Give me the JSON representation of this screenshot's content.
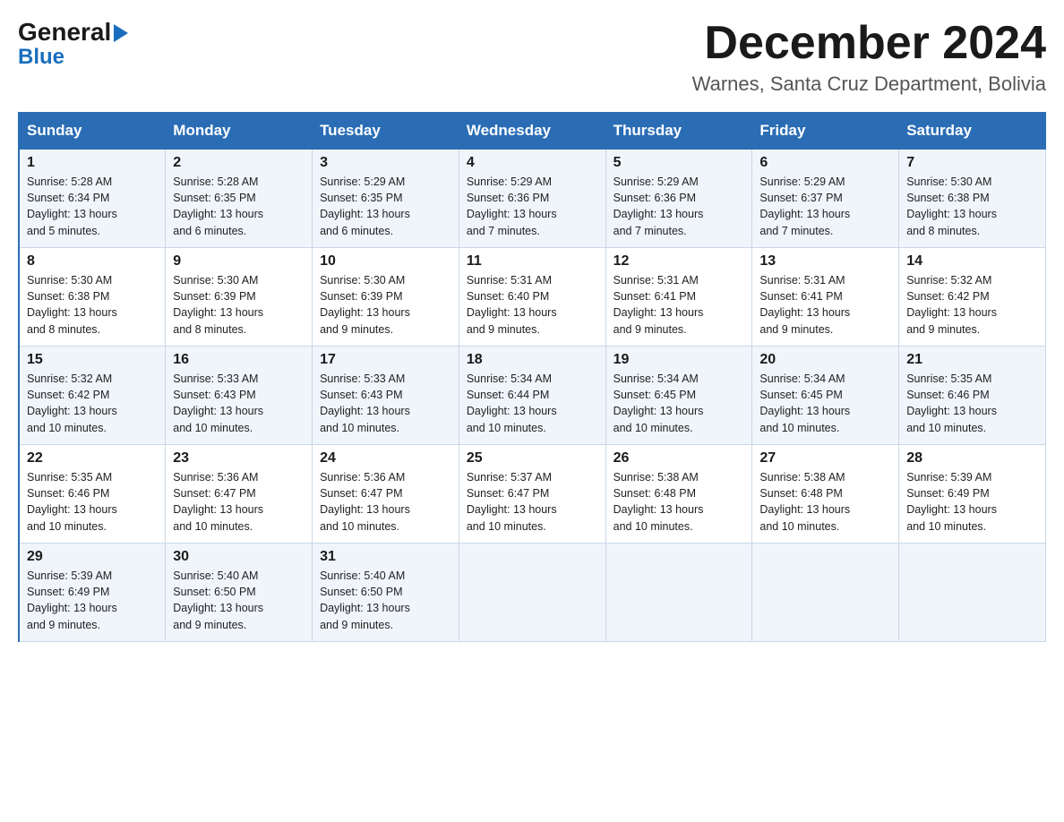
{
  "header": {
    "logo_general": "General",
    "logo_blue": "Blue",
    "month_title": "December 2024",
    "location": "Warnes, Santa Cruz Department, Bolivia"
  },
  "days_of_week": [
    "Sunday",
    "Monday",
    "Tuesday",
    "Wednesday",
    "Thursday",
    "Friday",
    "Saturday"
  ],
  "weeks": [
    [
      {
        "day": "1",
        "sunrise": "5:28 AM",
        "sunset": "6:34 PM",
        "daylight": "13 hours and 5 minutes."
      },
      {
        "day": "2",
        "sunrise": "5:28 AM",
        "sunset": "6:35 PM",
        "daylight": "13 hours and 6 minutes."
      },
      {
        "day": "3",
        "sunrise": "5:29 AM",
        "sunset": "6:35 PM",
        "daylight": "13 hours and 6 minutes."
      },
      {
        "day": "4",
        "sunrise": "5:29 AM",
        "sunset": "6:36 PM",
        "daylight": "13 hours and 7 minutes."
      },
      {
        "day": "5",
        "sunrise": "5:29 AM",
        "sunset": "6:36 PM",
        "daylight": "13 hours and 7 minutes."
      },
      {
        "day": "6",
        "sunrise": "5:29 AM",
        "sunset": "6:37 PM",
        "daylight": "13 hours and 7 minutes."
      },
      {
        "day": "7",
        "sunrise": "5:30 AM",
        "sunset": "6:38 PM",
        "daylight": "13 hours and 8 minutes."
      }
    ],
    [
      {
        "day": "8",
        "sunrise": "5:30 AM",
        "sunset": "6:38 PM",
        "daylight": "13 hours and 8 minutes."
      },
      {
        "day": "9",
        "sunrise": "5:30 AM",
        "sunset": "6:39 PM",
        "daylight": "13 hours and 8 minutes."
      },
      {
        "day": "10",
        "sunrise": "5:30 AM",
        "sunset": "6:39 PM",
        "daylight": "13 hours and 9 minutes."
      },
      {
        "day": "11",
        "sunrise": "5:31 AM",
        "sunset": "6:40 PM",
        "daylight": "13 hours and 9 minutes."
      },
      {
        "day": "12",
        "sunrise": "5:31 AM",
        "sunset": "6:41 PM",
        "daylight": "13 hours and 9 minutes."
      },
      {
        "day": "13",
        "sunrise": "5:31 AM",
        "sunset": "6:41 PM",
        "daylight": "13 hours and 9 minutes."
      },
      {
        "day": "14",
        "sunrise": "5:32 AM",
        "sunset": "6:42 PM",
        "daylight": "13 hours and 9 minutes."
      }
    ],
    [
      {
        "day": "15",
        "sunrise": "5:32 AM",
        "sunset": "6:42 PM",
        "daylight": "13 hours and 10 minutes."
      },
      {
        "day": "16",
        "sunrise": "5:33 AM",
        "sunset": "6:43 PM",
        "daylight": "13 hours and 10 minutes."
      },
      {
        "day": "17",
        "sunrise": "5:33 AM",
        "sunset": "6:43 PM",
        "daylight": "13 hours and 10 minutes."
      },
      {
        "day": "18",
        "sunrise": "5:34 AM",
        "sunset": "6:44 PM",
        "daylight": "13 hours and 10 minutes."
      },
      {
        "day": "19",
        "sunrise": "5:34 AM",
        "sunset": "6:45 PM",
        "daylight": "13 hours and 10 minutes."
      },
      {
        "day": "20",
        "sunrise": "5:34 AM",
        "sunset": "6:45 PM",
        "daylight": "13 hours and 10 minutes."
      },
      {
        "day": "21",
        "sunrise": "5:35 AM",
        "sunset": "6:46 PM",
        "daylight": "13 hours and 10 minutes."
      }
    ],
    [
      {
        "day": "22",
        "sunrise": "5:35 AM",
        "sunset": "6:46 PM",
        "daylight": "13 hours and 10 minutes."
      },
      {
        "day": "23",
        "sunrise": "5:36 AM",
        "sunset": "6:47 PM",
        "daylight": "13 hours and 10 minutes."
      },
      {
        "day": "24",
        "sunrise": "5:36 AM",
        "sunset": "6:47 PM",
        "daylight": "13 hours and 10 minutes."
      },
      {
        "day": "25",
        "sunrise": "5:37 AM",
        "sunset": "6:47 PM",
        "daylight": "13 hours and 10 minutes."
      },
      {
        "day": "26",
        "sunrise": "5:38 AM",
        "sunset": "6:48 PM",
        "daylight": "13 hours and 10 minutes."
      },
      {
        "day": "27",
        "sunrise": "5:38 AM",
        "sunset": "6:48 PM",
        "daylight": "13 hours and 10 minutes."
      },
      {
        "day": "28",
        "sunrise": "5:39 AM",
        "sunset": "6:49 PM",
        "daylight": "13 hours and 10 minutes."
      }
    ],
    [
      {
        "day": "29",
        "sunrise": "5:39 AM",
        "sunset": "6:49 PM",
        "daylight": "13 hours and 9 minutes."
      },
      {
        "day": "30",
        "sunrise": "5:40 AM",
        "sunset": "6:50 PM",
        "daylight": "13 hours and 9 minutes."
      },
      {
        "day": "31",
        "sunrise": "5:40 AM",
        "sunset": "6:50 PM",
        "daylight": "13 hours and 9 minutes."
      },
      null,
      null,
      null,
      null
    ]
  ],
  "labels": {
    "sunrise": "Sunrise:",
    "sunset": "Sunset:",
    "daylight": "Daylight:"
  }
}
